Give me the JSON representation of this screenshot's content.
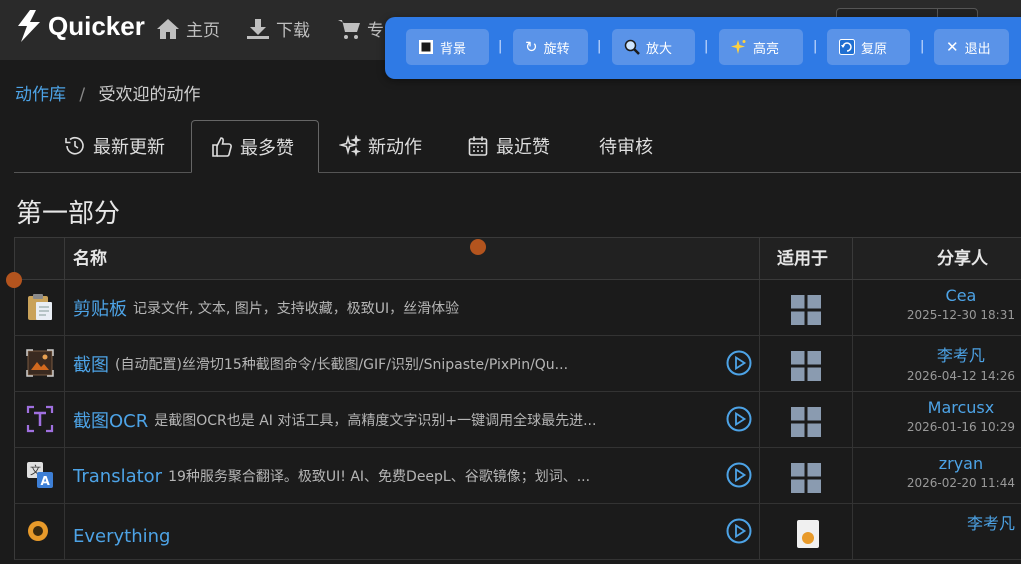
{
  "nav": {
    "logo_text": "Quicker",
    "items": [
      {
        "label": "主页",
        "icon": "home-icon"
      },
      {
        "label": "下载",
        "icon": "download-icon"
      },
      {
        "label": "专",
        "icon": "cart-icon"
      }
    ]
  },
  "toolbar": {
    "buttons": [
      {
        "label": "背景",
        "icon": "square-icon"
      },
      {
        "label": "旋转",
        "icon": "rotate-icon"
      },
      {
        "label": "放大",
        "icon": "magnifier-icon"
      },
      {
        "label": "高亮",
        "icon": "sparkle-icon"
      },
      {
        "label": "复原",
        "icon": "restore-icon"
      },
      {
        "label": "退出",
        "icon": "close-icon"
      }
    ],
    "separator": "|"
  },
  "breadcrumb": {
    "root": "动作库",
    "separator": "/",
    "current": "受欢迎的动作"
  },
  "tabs": [
    {
      "label": "最新更新",
      "icon": "history-icon"
    },
    {
      "label": "最多赞",
      "icon": "thumbs-up-icon",
      "active": true
    },
    {
      "label": "新动作",
      "icon": "sparkles-icon"
    },
    {
      "label": "最近赞",
      "icon": "calendar-icon"
    },
    {
      "label": "待审核",
      "icon": ""
    }
  ],
  "section_title": "第一部分",
  "table": {
    "headers": {
      "name": "名称",
      "applies": "适用于",
      "sharer": "分享人"
    },
    "rows": [
      {
        "title": "剪贴板",
        "desc": "记录文件, 文本, 图片，支持收藏，极致UI，丝滑体验",
        "sharer": "Cea",
        "date": "2025-12-30 18:31",
        "icon": "clipboard-icon",
        "play": false
      },
      {
        "title": "截图",
        "desc": "(自动配置)丝滑切15种截图命令/长截图/GIF/识别/Snipaste/PixPin/Qu...",
        "sharer": "李考凡",
        "date": "2026-04-12 14:26",
        "icon": "screenshot-icon",
        "play": true
      },
      {
        "title": "截图OCR",
        "desc": "是截图OCR也是 AI 对话工具，高精度文字识别+一键调用全球最先进...",
        "sharer": "Marcusx",
        "date": "2026-01-16 10:29",
        "icon": "ocr-icon",
        "play": true
      },
      {
        "title": "Translator",
        "desc": "19种服务聚合翻译。极致UI! AI、免费DeepL、谷歌镜像；划词、...",
        "sharer": "zryan",
        "date": "2026-02-20 11:44",
        "icon": "translate-icon",
        "play": true
      },
      {
        "title": "Everything",
        "desc": "",
        "sharer": "李考凡",
        "date": "",
        "icon": "everything-icon",
        "play": true
      }
    ]
  },
  "colors": {
    "accent": "#4da3e6",
    "toolbar": "#2f7ae5",
    "dot": "#b3541e"
  }
}
